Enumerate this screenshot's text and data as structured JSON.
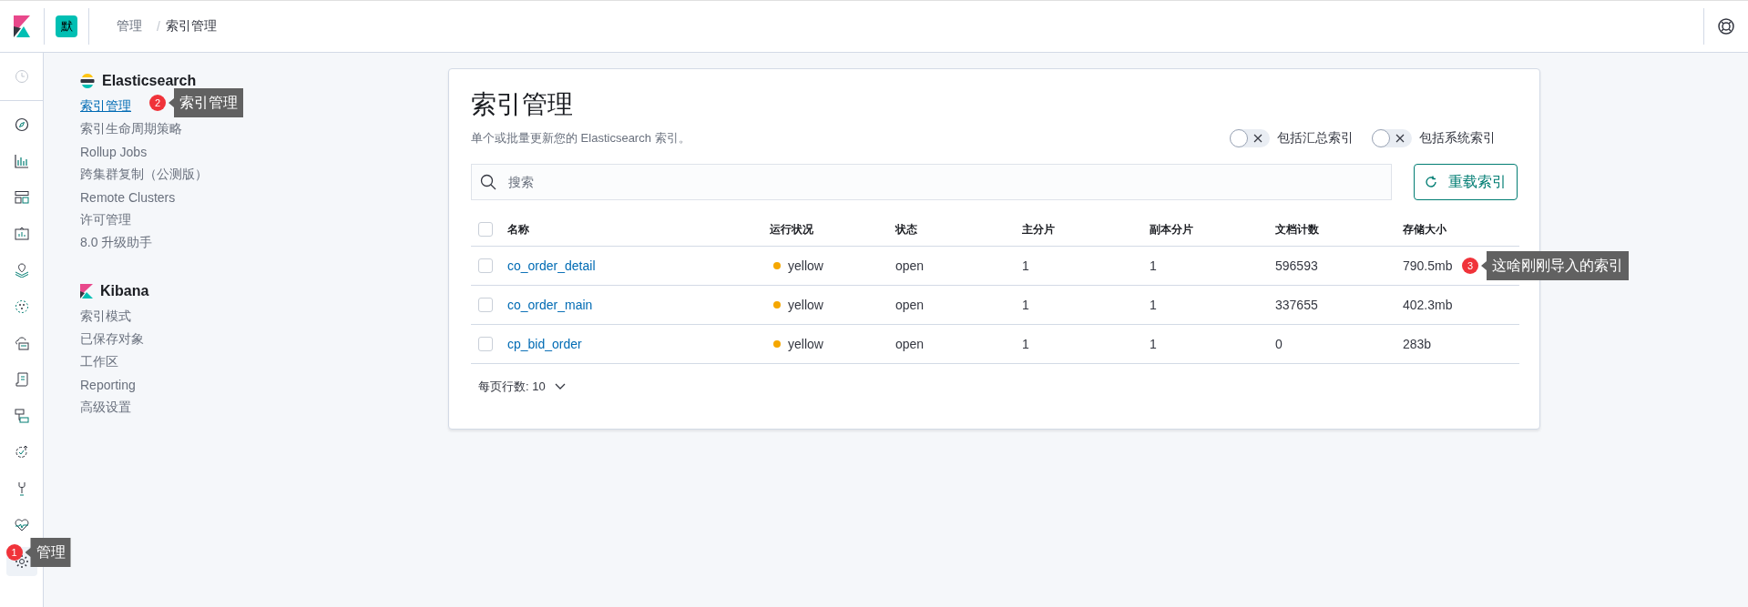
{
  "header": {
    "space_avatar": "默",
    "breadcrumbs": [
      "管理",
      "索引管理"
    ],
    "breadcrumb_separator": "/"
  },
  "nav_rail": [
    {
      "selected": false
    },
    {
      "selected": false
    },
    {
      "selected": false
    },
    {
      "selected": false
    },
    {
      "selected": false
    },
    {
      "selected": false
    },
    {
      "selected": false
    },
    {
      "selected": false
    },
    {
      "selected": false
    },
    {
      "selected": false
    },
    {
      "selected": false
    },
    {
      "selected": false
    },
    {
      "selected": false
    },
    {
      "selected": true,
      "annotation": {
        "number": "1",
        "text": "管理"
      }
    }
  ],
  "sidebar": {
    "sections": [
      {
        "kind": "elasticsearch",
        "title": "Elasticsearch",
        "items": [
          {
            "label": "索引管理",
            "selected": true,
            "annotation": {
              "number": "2",
              "text": "索引管理"
            }
          },
          {
            "label": "索引生命周期策略",
            "selected": false
          },
          {
            "label": "Rollup Jobs",
            "selected": false
          },
          {
            "label": "跨集群复制（公测版）",
            "selected": false
          },
          {
            "label": "Remote Clusters",
            "selected": false
          },
          {
            "label": "许可管理",
            "selected": false
          },
          {
            "label": "8.0 升级助手",
            "selected": false
          }
        ]
      },
      {
        "kind": "kibana",
        "title": "Kibana",
        "items": [
          {
            "label": "索引模式",
            "selected": false
          },
          {
            "label": "已保存对象",
            "selected": false
          },
          {
            "label": "工作区",
            "selected": false
          },
          {
            "label": "Reporting",
            "selected": false
          },
          {
            "label": "高级设置",
            "selected": false
          }
        ]
      }
    ]
  },
  "panel": {
    "title": "索引管理",
    "description": "单个或批量更新您的 Elasticsearch 索引。",
    "toggles": [
      {
        "label": "包括汇总索引",
        "on": false
      },
      {
        "label": "包括系统索引",
        "on": false
      }
    ],
    "search": {
      "placeholder": "搜索"
    },
    "reload_button": "重载索引",
    "table": {
      "select_all_checked": false,
      "columns": [
        "名称",
        "运行状况",
        "状态",
        "主分片",
        "副本分片",
        "文档计数",
        "存储大小"
      ],
      "rows": [
        {
          "checked": false,
          "name": "co_order_detail",
          "health": "yellow",
          "color": "#f5a700",
          "status": "open",
          "primaries": "1",
          "replicas": "1",
          "docs_count": "596593",
          "storage_size": "790.5mb",
          "annotation": {
            "number": "3",
            "text": "这啥刚刚导入的索引"
          }
        },
        {
          "checked": false,
          "name": "co_order_main",
          "health": "yellow",
          "color": "#f5a700",
          "status": "open",
          "primaries": "1",
          "replicas": "1",
          "docs_count": "337655",
          "storage_size": "402.3mb"
        },
        {
          "checked": false,
          "name": "cp_bid_order",
          "health": "yellow",
          "color": "#f5a700",
          "status": "open",
          "primaries": "1",
          "replicas": "1",
          "docs_count": "0",
          "storage_size": "283b"
        }
      ]
    },
    "pagination": "每页行数: 10"
  }
}
